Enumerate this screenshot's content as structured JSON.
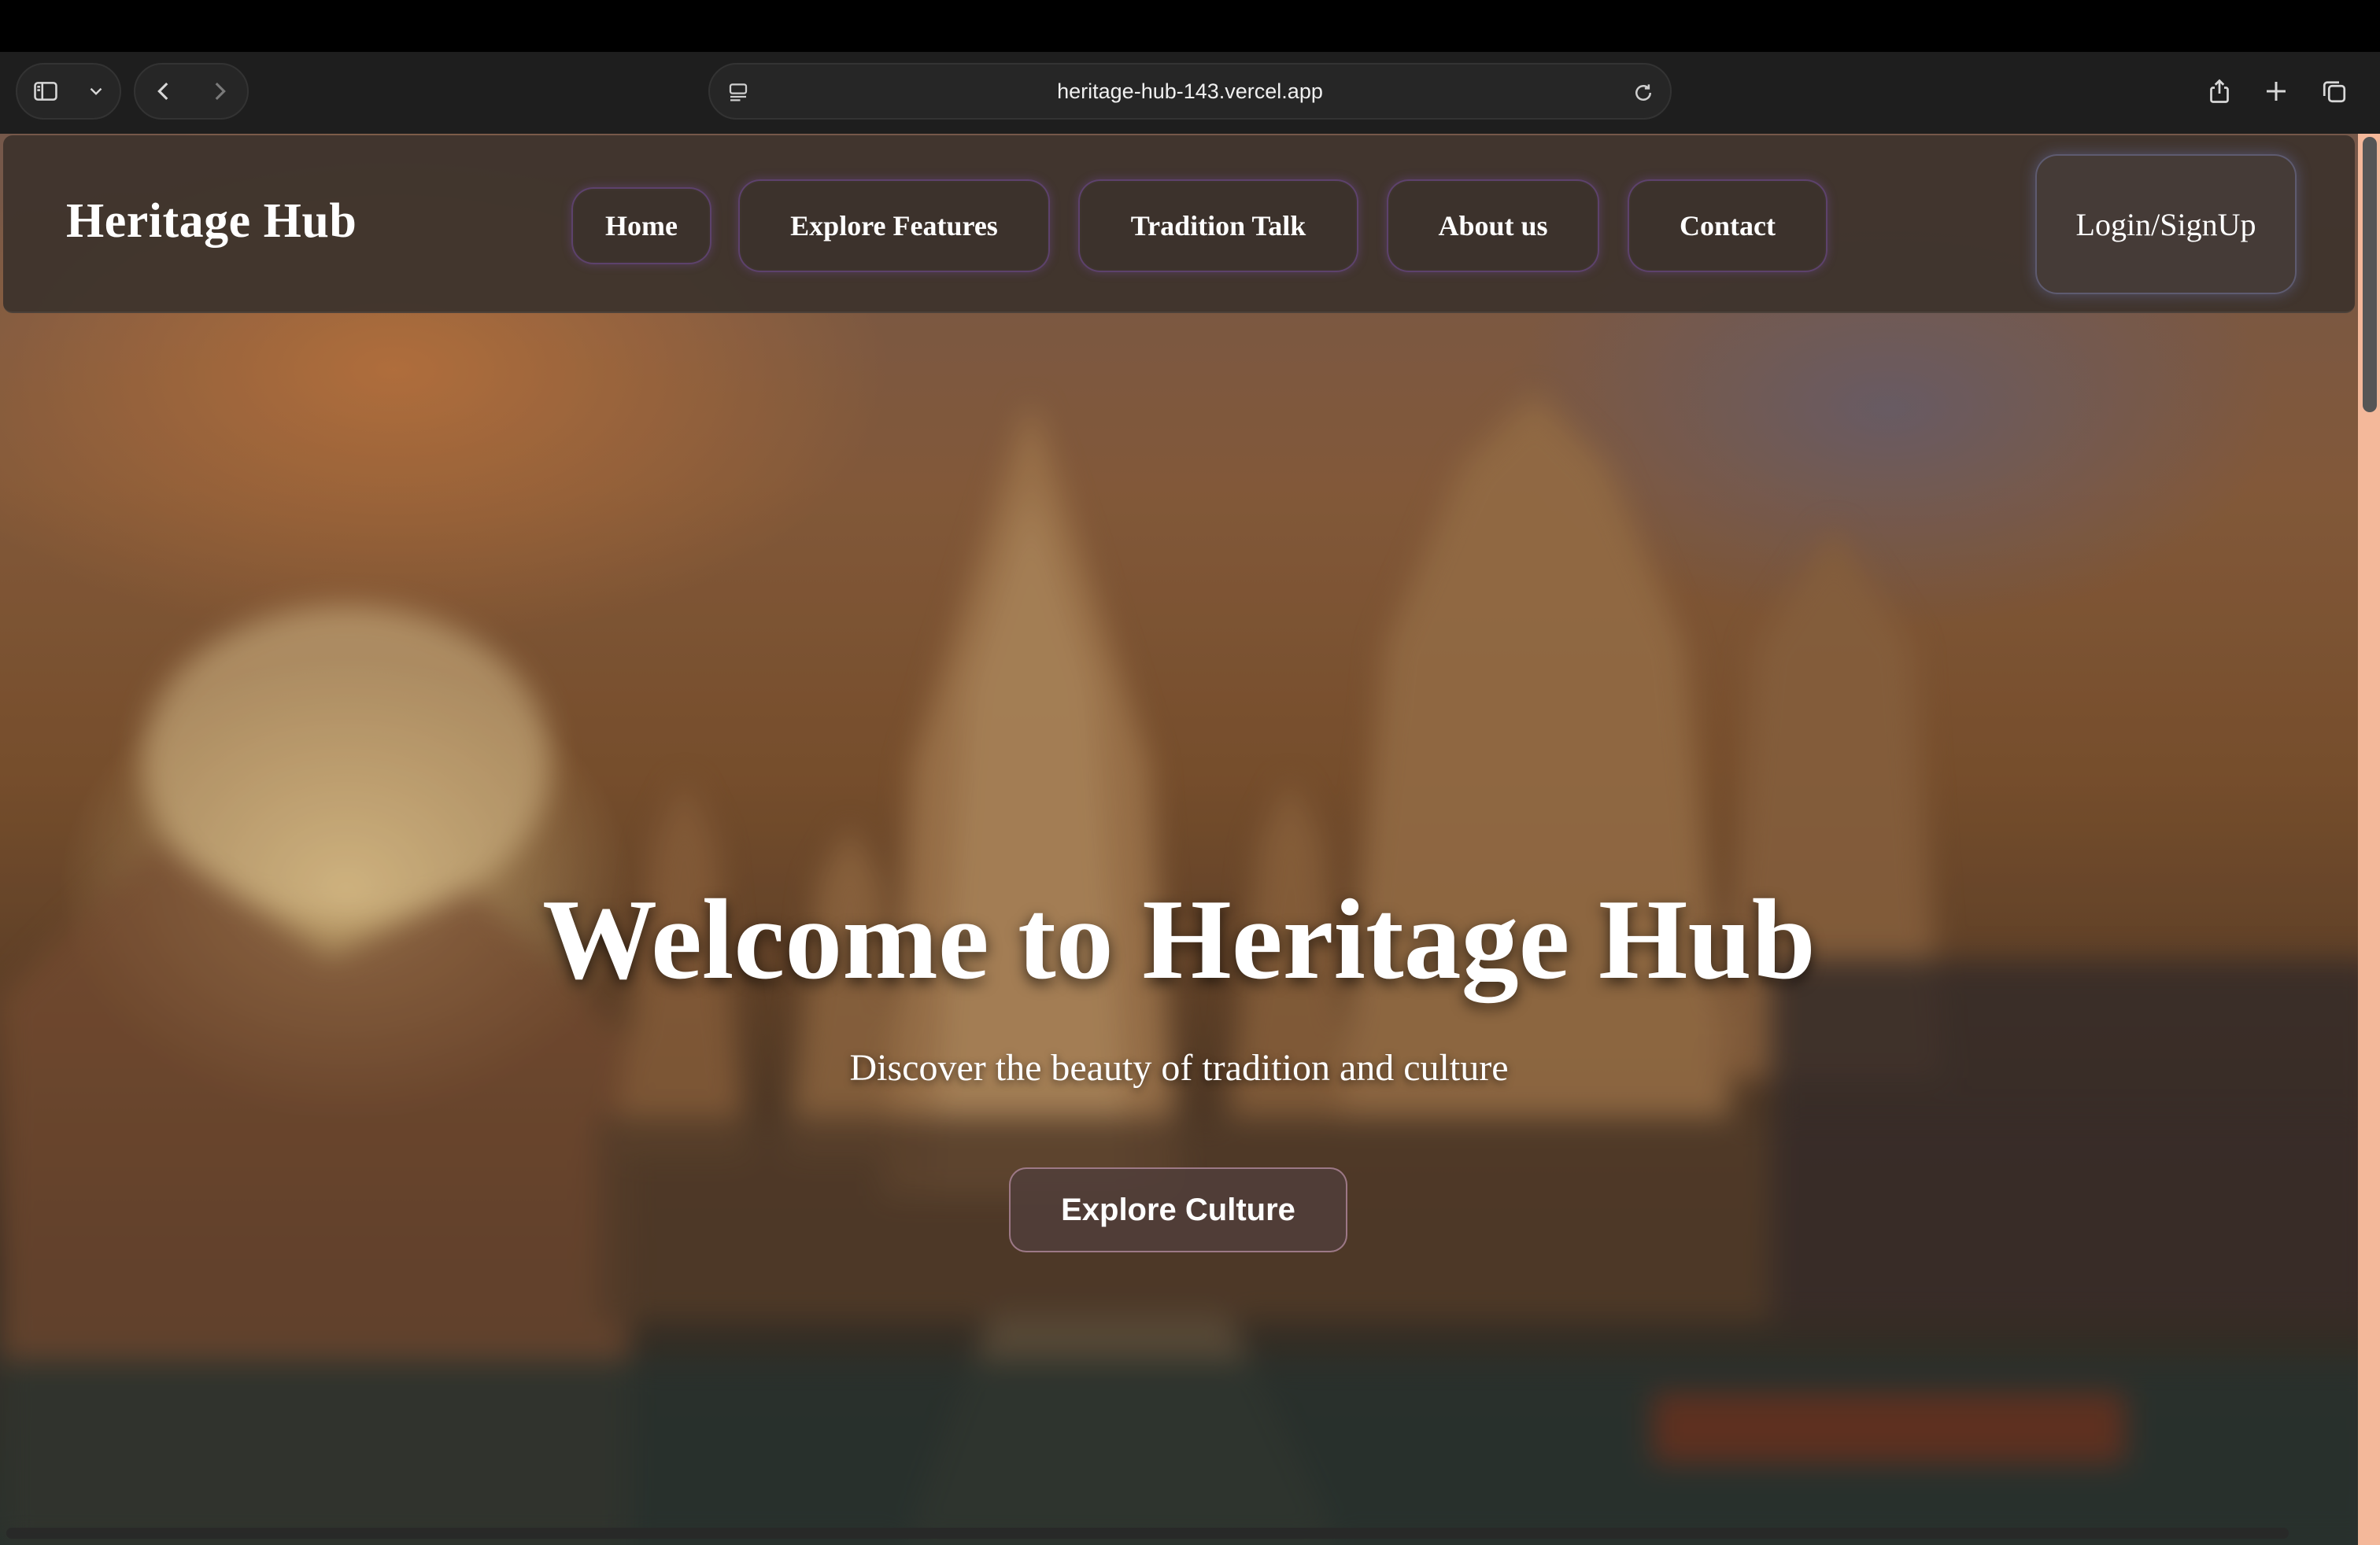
{
  "browser": {
    "url": "heritage-hub-143.vercel.app",
    "icons": {
      "sidebar": "sidebar-icon",
      "chevron": "chevron-down-icon",
      "back": "back-arrow-icon",
      "forward": "forward-arrow-icon",
      "page": "page-settings-icon",
      "reload": "reload-icon",
      "share": "share-icon",
      "new_tab": "plus-icon",
      "tabs": "tabs-overview-icon"
    }
  },
  "nav": {
    "brand": "Heritage Hub",
    "links": [
      "Home",
      "Explore Features",
      "Tradition Talk",
      "About us",
      "Contact"
    ],
    "login": "Login/SignUp"
  },
  "hero": {
    "title": "Welcome to Heritage Hub",
    "subtitle": "Discover the beauty of tradition and culture",
    "cta": "Explore Culture"
  },
  "colors": {
    "nav_bg": "#3e342d",
    "link_glow": "#8250be",
    "scroll_track": "#f4b89a"
  }
}
